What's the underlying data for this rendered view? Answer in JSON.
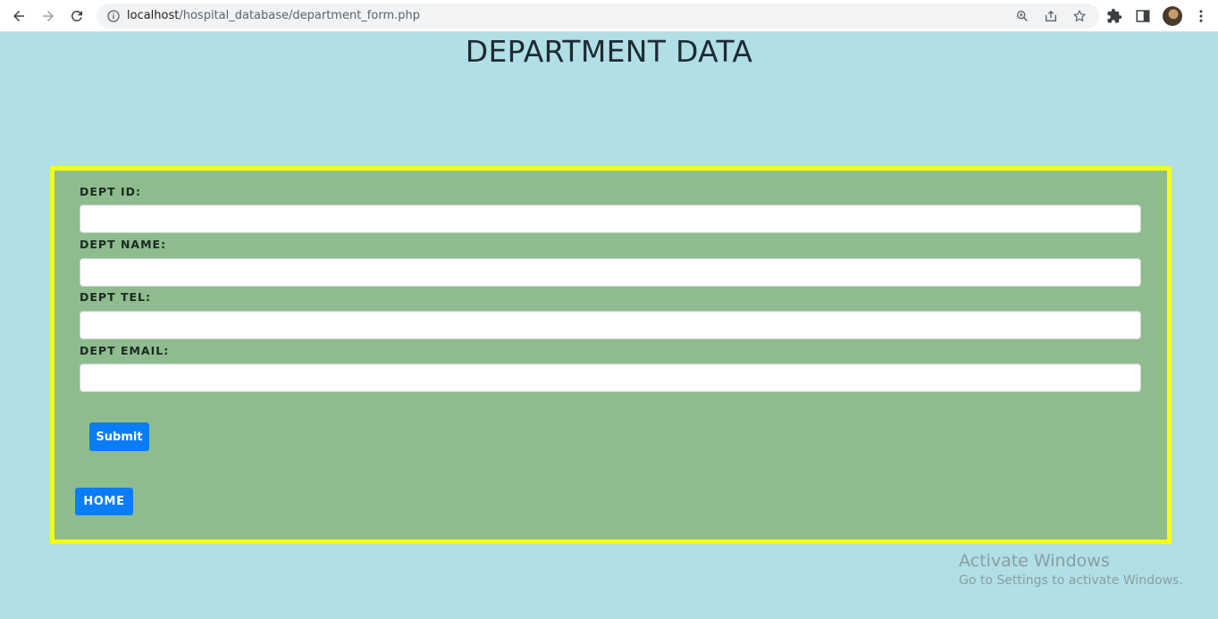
{
  "browser": {
    "url_host": "localhost",
    "url_path": "/hospital_database/department_form.php"
  },
  "page": {
    "title": "DEPARTMENT DATA",
    "background_color": "#b0dfe5",
    "form_background_color": "#8fbc8f",
    "form_border_color": "#f4ff12",
    "button_color": "#0a7cf6"
  },
  "form": {
    "fields": [
      {
        "label": "DEPT ID:",
        "value": ""
      },
      {
        "label": "DEPT NAME:",
        "value": ""
      },
      {
        "label": "DEPT TEL:",
        "value": ""
      },
      {
        "label": "DEPT EMAIL:",
        "value": ""
      }
    ],
    "submit_label": "Submit",
    "home_label": "HOME"
  },
  "watermark": {
    "title": "Activate Windows",
    "subtitle": "Go to Settings to activate Windows."
  }
}
